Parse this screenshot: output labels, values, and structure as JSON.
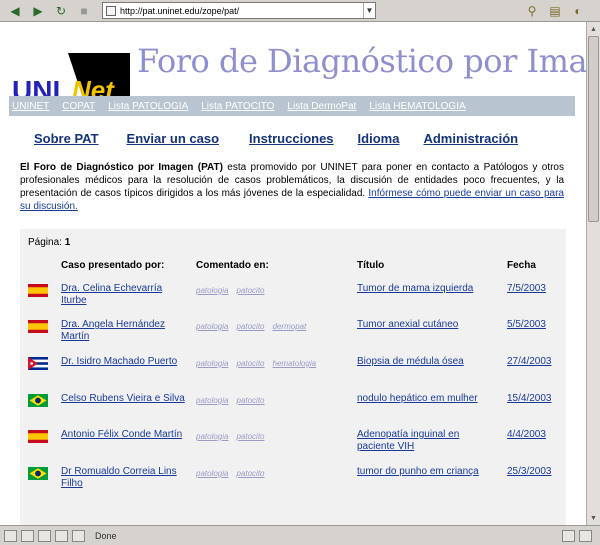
{
  "browser": {
    "url": "http://pat.uninet.edu/zope/pat/",
    "status": "Done"
  },
  "site": {
    "logo_text_1": "UNI",
    "logo_text_2": "Net",
    "title": "Foro de Diagnóstico por Imagen"
  },
  "graynav": [
    "UNINET",
    "COPAT",
    "Lista PATOLOGIA",
    "Lista PATOCITO",
    "Lista DermoPat",
    "Lista HEMATOLOGIA"
  ],
  "mainnav": [
    "Sobre PAT",
    "Enviar un caso",
    "Instrucciones",
    "Idioma",
    "Administración"
  ],
  "intro": {
    "bold": "El Foro de Diagnóstico por Imagen (PAT)",
    "text": " esta promovido por UNINET para poner en contacto a Patólogos y otros profesionales médicos para la resolución de casos problemáticos, la discusión de entidades poco frecuentes, y la presentación de casos típicos dirigidos a los más jóvenes de la especialidad. ",
    "link": "Infórmese cómo puede enviar un caso para su discusión."
  },
  "cases": {
    "page_label": "Página:",
    "page_number": "1",
    "headers": {
      "presented_by": "Caso presentado por:",
      "commented_in": "Comentado en:",
      "title": "Título",
      "date": "Fecha"
    },
    "rows": [
      {
        "flag": "spain",
        "author": "Dra. Celina Echevarría Iturbe",
        "comments": [
          "patologia",
          "patocito"
        ],
        "title": "Tumor de mama izquierda",
        "date": "7/5/2003"
      },
      {
        "flag": "spain",
        "author": "Dra. Angela Hernández Martín",
        "comments": [
          "patologia",
          "patocito",
          "dermopat"
        ],
        "title": "Tumor anexial cutáneo",
        "date": "5/5/2003"
      },
      {
        "flag": "cuba",
        "author": "Dr. Isidro Machado Puerto",
        "comments": [
          "patologia",
          "patocito",
          "hematologia"
        ],
        "title": "Biopsia de médula ósea",
        "date": "27/4/2003"
      },
      {
        "flag": "brazil",
        "author": "Celso Rubens Vieira e Silva",
        "comments": [
          "patologia",
          "patocito"
        ],
        "title": "nodulo hepático em mulher",
        "date": "15/4/2003"
      },
      {
        "flag": "spain",
        "author": "Antonio Félix Conde Martín",
        "comments": [
          "patologia",
          "patocito"
        ],
        "title": "Adenopatía inguinal en paciente VIH",
        "date": "4/4/2003"
      },
      {
        "flag": "brazil",
        "author": "Dr Romualdo Correia Lins Filho",
        "comments": [
          "patologia",
          "patocito"
        ],
        "title": "tumor do punho em criança",
        "date": "25/3/2003"
      }
    ]
  }
}
